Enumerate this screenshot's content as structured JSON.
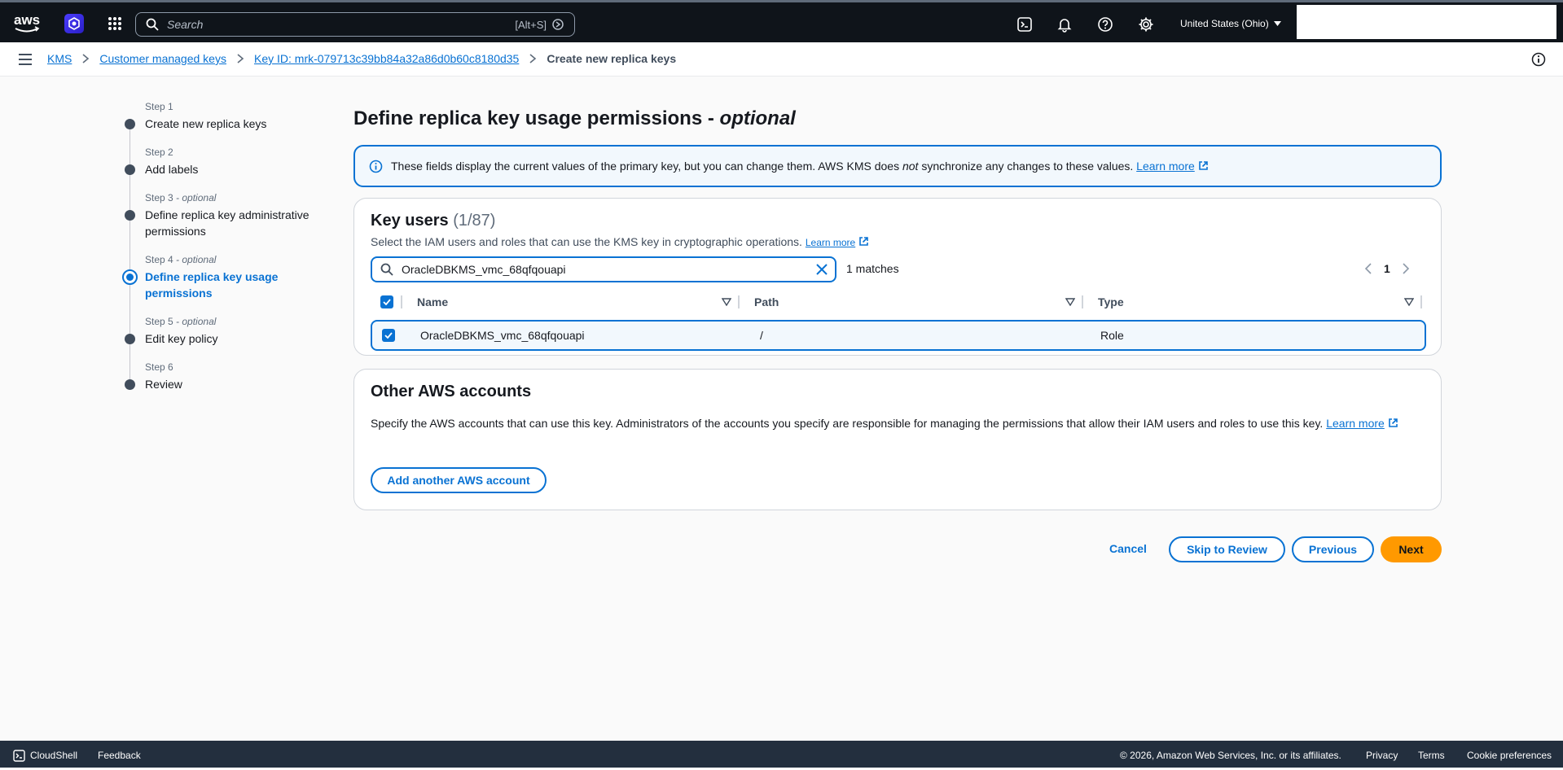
{
  "colors": {
    "primary": "#0972d3",
    "nav_bg": "#0f141a",
    "accent": "#ff9900",
    "footer_bg": "#232f3e"
  },
  "topnav": {
    "logo_text": "aws",
    "search_placeholder": "Search",
    "search_shortcut": "[Alt+S]",
    "region": "United States (Ohio)",
    "icons": [
      "cloudshell-icon",
      "bell-icon",
      "help-icon",
      "gear-icon"
    ]
  },
  "breadcrumb": {
    "items": [
      "KMS",
      "Customer managed keys",
      "Key ID: mrk-079713c39bb84a32a86d0b60c8180d35"
    ],
    "current": "Create new replica keys"
  },
  "steps": [
    {
      "label": "Step 1",
      "optional": "",
      "title": "Create new replica keys"
    },
    {
      "label": "Step 2",
      "optional": "",
      "title": "Add labels"
    },
    {
      "label": "Step 3",
      "optional": " - optional",
      "title": "Define replica key administrative permissions"
    },
    {
      "label": "Step 4",
      "optional": " - optional",
      "title": "Define replica key usage permissions",
      "active": true
    },
    {
      "label": "Step 5",
      "optional": " - optional",
      "title": "Edit key policy"
    },
    {
      "label": "Step 6",
      "optional": "",
      "title": "Review"
    }
  ],
  "page": {
    "title": "Define replica key usage permissions - ",
    "title_optional": "optional"
  },
  "alert": {
    "text_before": "These fields display the current values of the primary key, but you can change them. AWS KMS does ",
    "text_em": "not",
    "text_after": " synchronize any changes to these values.",
    "link": "Learn more"
  },
  "key_users": {
    "title": "Key users",
    "count": "(1/87)",
    "description": "Select the IAM users and roles that can use the KMS key in cryptographic operations.",
    "learn_more": "Learn more",
    "filter_value": "OracleDBKMS_vmc_68qfqouapi",
    "matches": "1 matches",
    "page": "1",
    "columns": [
      "Name",
      "Path",
      "Type"
    ],
    "rows": [
      {
        "name": "OracleDBKMS_vmc_68qfqouapi",
        "path": "/",
        "type": "Role",
        "selected": true
      }
    ]
  },
  "other_accounts": {
    "title": "Other AWS accounts",
    "description": "Specify the AWS accounts that can use this key. Administrators of the accounts you specify are responsible for managing the permissions that allow their IAM users and roles to use this key.",
    "learn_more": "Learn more",
    "add_button": "Add another AWS account"
  },
  "actions": {
    "cancel": "Cancel",
    "skip": "Skip to Review",
    "previous": "Previous",
    "next": "Next"
  },
  "footer": {
    "cloudshell": "CloudShell",
    "feedback": "Feedback",
    "copyright": "© 2026, Amazon Web Services, Inc. or its affiliates.",
    "privacy": "Privacy",
    "terms": "Terms",
    "cookies": "Cookie preferences"
  }
}
